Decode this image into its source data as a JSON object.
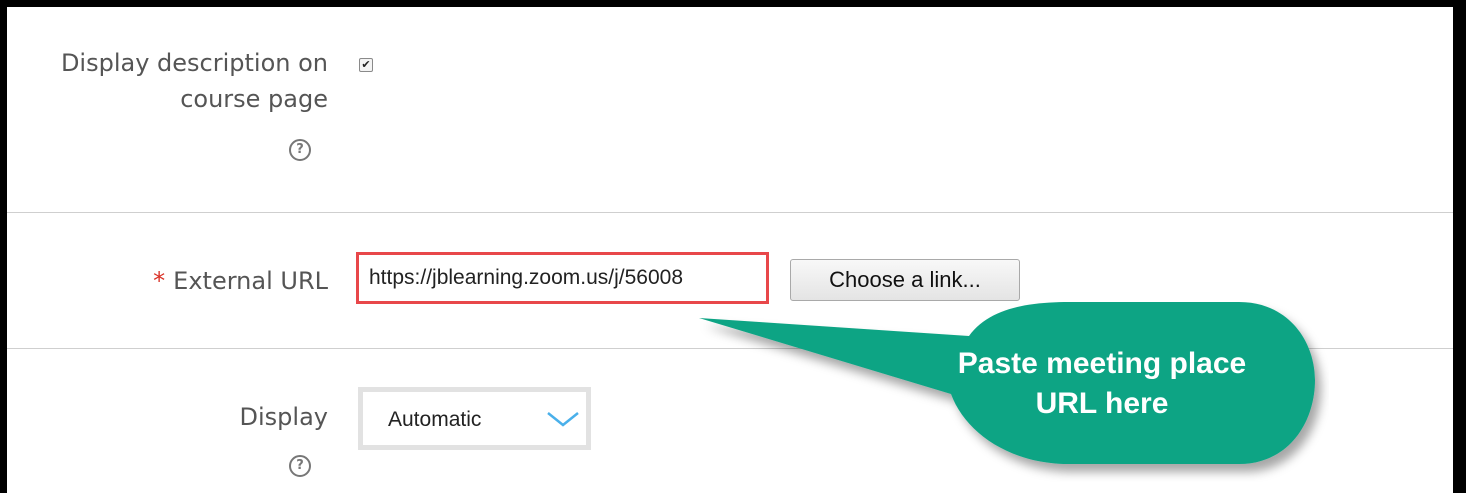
{
  "fields": {
    "display_description": {
      "label": "Display description on course page",
      "checked": true
    },
    "external_url": {
      "required_marker": "*",
      "label": "External URL",
      "value": "https://jblearning.zoom.us/j/56008",
      "choose_button_label": "Choose a link..."
    },
    "display": {
      "label": "Display",
      "selected": "Automatic"
    }
  },
  "callout": {
    "text": "Paste meeting place URL here",
    "color": "#0fa484"
  },
  "highlight": {
    "color": "#e8474a"
  },
  "icons": {
    "help": "question-circle-icon",
    "checkbox_check": "check-icon",
    "dropdown": "chevron-down-icon"
  }
}
